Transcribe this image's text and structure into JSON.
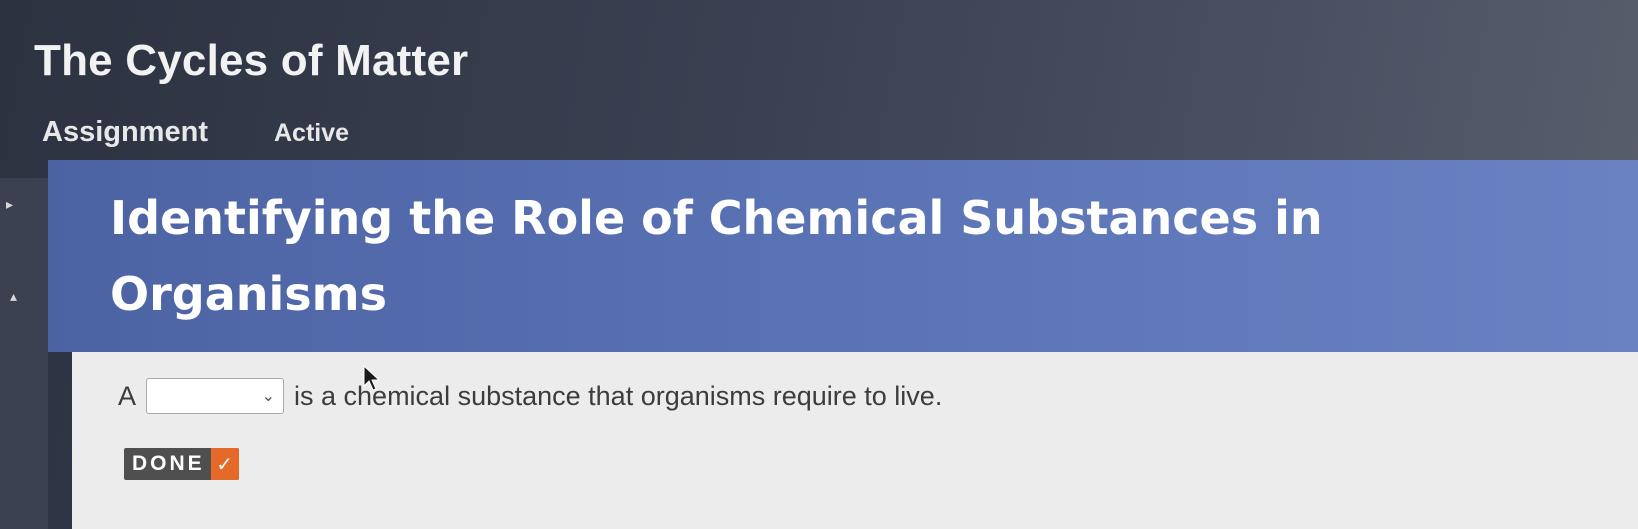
{
  "header": {
    "title": "The Cycles of Matter",
    "type_label": "Assignment",
    "status": "Active"
  },
  "lesson": {
    "title": "Identifying the Role of Chemical Substances in Organisms"
  },
  "question": {
    "prefix": "A",
    "blank_value": "",
    "suffix": "is a chemical substance that organisms require to live."
  },
  "done_button": {
    "label": "DONE",
    "icon": "check-icon",
    "icon_glyph": "✓"
  },
  "icons": {
    "dropdown": "chevron-down-icon",
    "dropdown_glyph": "⌄"
  },
  "colors": {
    "heading_band": "#5a73b5",
    "done_check": "#e56a2a",
    "background": "#3a4152"
  }
}
